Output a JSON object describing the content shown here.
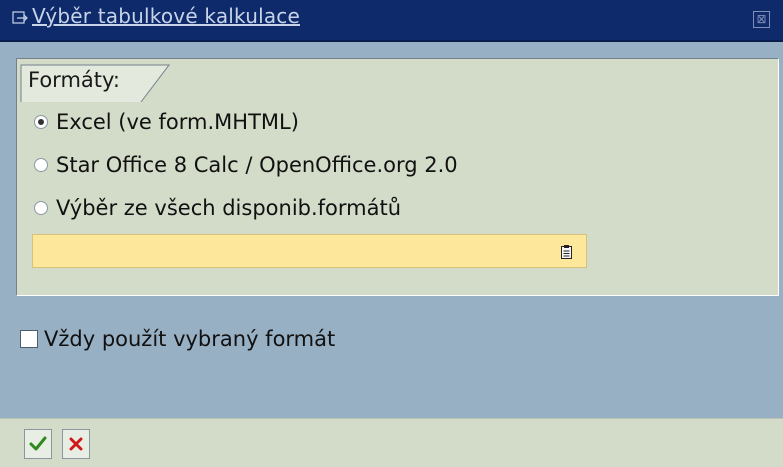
{
  "window": {
    "title": "Výběr tabulkové kalkulace",
    "close_symbol": "⊠"
  },
  "group": {
    "label": "Formáty:"
  },
  "options": [
    {
      "label": "Excel (ve form.MHTML)",
      "checked": true
    },
    {
      "label": "Star Office 8 Calc / OpenOffice.org 2.0",
      "checked": false
    },
    {
      "label": "Výběr ze všech disponib.formátů",
      "checked": false
    }
  ],
  "format_input": {
    "value": "",
    "icon": "value-help-icon"
  },
  "always_use": {
    "label": "Vždy použít vybraný formát",
    "checked": false
  },
  "footer": {
    "confirm_icon": "green-check-icon",
    "cancel_icon": "red-cross-icon"
  },
  "colors": {
    "title_bar": "#0f2a6b",
    "window_bg": "#98b0c4",
    "group_bg": "#d3dbc9",
    "input_bg": "#fde79b",
    "confirm": "#2f8a1d",
    "cancel": "#d01818"
  }
}
